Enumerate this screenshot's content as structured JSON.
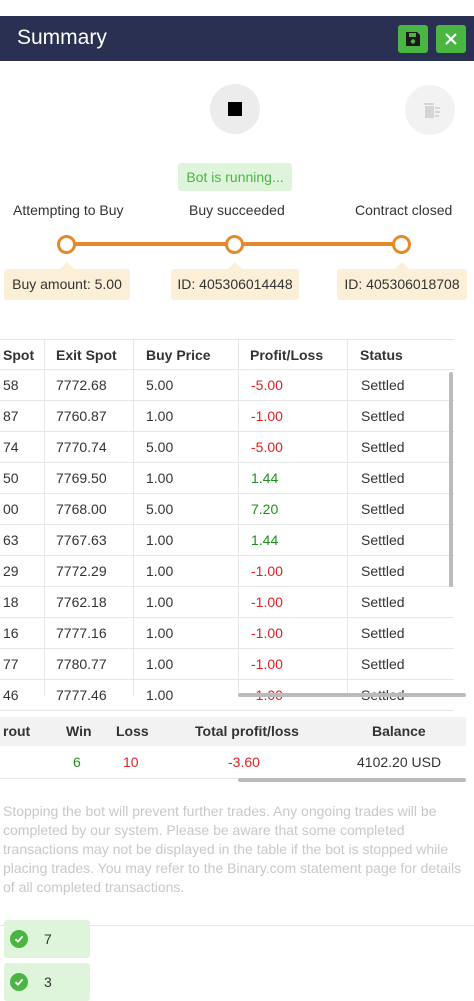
{
  "header": {
    "title": "Summary",
    "save_icon": "floppy-disk-icon",
    "close_icon": "close-icon"
  },
  "controls": {
    "stop_icon": "stop-icon",
    "clear_icon": "trash-icon"
  },
  "status": "Bot is running...",
  "progress": {
    "steps": [
      "Attempting to Buy",
      "Buy succeeded",
      "Contract closed"
    ],
    "tips": [
      "Buy amount: 5.00",
      "ID: 405306014448",
      "ID: 405306018708"
    ],
    "color": "#e48a2a"
  },
  "transactions": {
    "headers": [
      "Spot",
      "Exit Spot",
      "Buy Price",
      "Profit/Loss",
      "Status"
    ],
    "rows": [
      [
        "58",
        "7772.68",
        "5.00",
        "-5.00",
        "Settled"
      ],
      [
        "87",
        "7760.87",
        "1.00",
        "-1.00",
        "Settled"
      ],
      [
        "74",
        "7770.74",
        "5.00",
        "-5.00",
        "Settled"
      ],
      [
        "50",
        "7769.50",
        "1.00",
        "1.44",
        "Settled"
      ],
      [
        "00",
        "7768.00",
        "5.00",
        "7.20",
        "Settled"
      ],
      [
        "63",
        "7767.63",
        "1.00",
        "1.44",
        "Settled"
      ],
      [
        "29",
        "7772.29",
        "1.00",
        "-1.00",
        "Settled"
      ],
      [
        "18",
        "7762.18",
        "1.00",
        "-1.00",
        "Settled"
      ],
      [
        "16",
        "7777.16",
        "1.00",
        "-1.00",
        "Settled"
      ],
      [
        "77",
        "7780.77",
        "1.00",
        "-1.00",
        "Settled"
      ],
      [
        "46",
        "7777.46",
        "1.00",
        "-1.00",
        "Settled"
      ]
    ]
  },
  "summary": {
    "headers": [
      "rout",
      "Win",
      "Loss",
      "Total profit/loss",
      "Balance"
    ],
    "values": [
      "",
      "6",
      "10",
      "-3.60",
      "4102.20 USD"
    ]
  },
  "notice": "Stopping the bot will prevent further trades. Any ongoing trades will be completed by our system. Please be aware that some completed transactions may not be displayed in the table if the bot is stopped while placing trades. You may refer to the Binary.com statement page for details of all completed transactions.",
  "toasts": [
    "7",
    "3"
  ],
  "colors": {
    "header_bg": "#2a3052",
    "success": "#4bb543",
    "loss": "#d22222",
    "profit": "#1e8f1e"
  }
}
